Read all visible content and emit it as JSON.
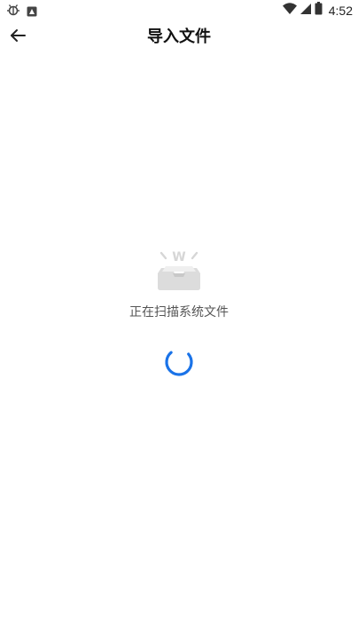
{
  "status_bar": {
    "time": "4:52",
    "left_icons": [
      "bug-icon",
      "app-notification-icon"
    ],
    "right_icons": [
      "wifi-icon",
      "cellular-signal-icon",
      "battery-icon"
    ]
  },
  "header": {
    "back_icon": "arrow-left-icon",
    "title": "导入文件"
  },
  "main": {
    "illustration_icon": "inbox-tray-w-icon",
    "illustration_letter": "W",
    "status_text": "正在扫描系统文件",
    "spinner_icon": "loading-spinner-icon"
  },
  "colors": {
    "spinner": "#1a73e8",
    "tray": "#dcdcdc",
    "text_secondary": "#555555"
  }
}
